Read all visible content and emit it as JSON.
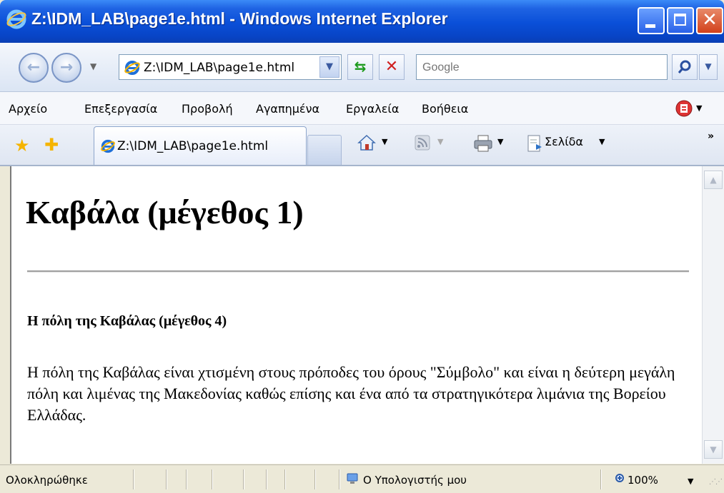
{
  "window": {
    "title": "Z:\\IDM_LAB\\page1e.html - Windows Internet Explorer",
    "minimize_label": "",
    "maximize_label": "",
    "close_label": "✕"
  },
  "nav": {
    "address": "Z:\\IDM_LAB\\page1e.html",
    "search_placeholder": "Google"
  },
  "menu": {
    "items": [
      "Αρχείο",
      "Επεξεργασία",
      "Προβολή",
      "Αγαπημένα",
      "Εργαλεία",
      "Βοήθεια"
    ]
  },
  "tabs": {
    "active_tab": "Z:\\IDM_LAB\\page1e.html",
    "page_menu": "Σελίδα"
  },
  "page": {
    "heading": "Καβάλα (μέγεθος 1)",
    "subheading": "Η πόλη της Καβάλας (μέγεθος 4)",
    "paragraph": "Η πόλη της Καβάλας είναι χτισμένη στους πρόποδες του όρους \"Σύμβολο\" και είναι η δεύτερη μεγάλη πόλη και λιμένας της Μακεδονίας καθώς επίσης και ένα από τα στρατηγικότερα λιμάνια της Βορείου Ελλάδας."
  },
  "status": {
    "text": "Ολοκληρώθηκε",
    "zone": "Ο Υπολογιστής μου",
    "zoom": "100%"
  },
  "colors": {
    "titlebar": "#0a4fd8",
    "close_button": "#d2411b"
  }
}
